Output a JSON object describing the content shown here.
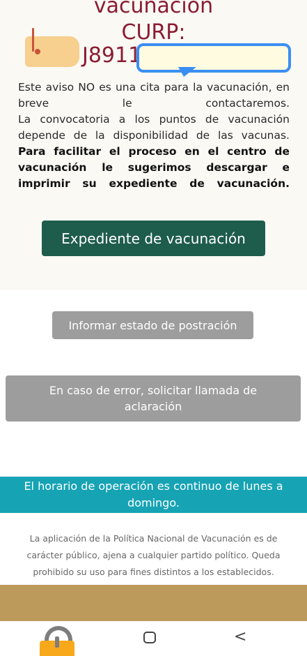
{
  "header": {
    "title_line1": "vacunación",
    "title_line2": "CURP:",
    "curp_value": "J8911"
  },
  "notice": {
    "para1": "Este aviso NO es una cita para la vacunación, en breve le contactaremos.",
    "para2": "La convocatoria a los puntos de vacunación depende de la disponibilidad de las vacunas.",
    "para3": "Para facilitar el proceso en el centro de vacunación le sugerimos descargar e imprimir su expediente de vacunación."
  },
  "buttons": {
    "expediente": "Expediente de vacunación",
    "postracion": "Informar estado de postración",
    "aclaracion": "En caso de error, solicitar llamada de aclaración"
  },
  "banner": {
    "horario": "El horario de operación es continuo de lunes a domingo."
  },
  "disclaimer": {
    "text": "La aplicación de la Política Nacional de Vacunación es de carácter público, ajena a cualquier partido político. Queda prohibido su uso para fines distintos a los establecidos."
  },
  "nav": {
    "back_glyph": "<",
    "icons": [
      "lock-icon",
      "home-icon",
      "back-icon"
    ]
  },
  "colors": {
    "title": "#8a1c32",
    "primary_button": "#1e5c4c",
    "gray_button": "#9d9d9d",
    "banner": "#16a3b4",
    "band": "#bc9a5c"
  }
}
